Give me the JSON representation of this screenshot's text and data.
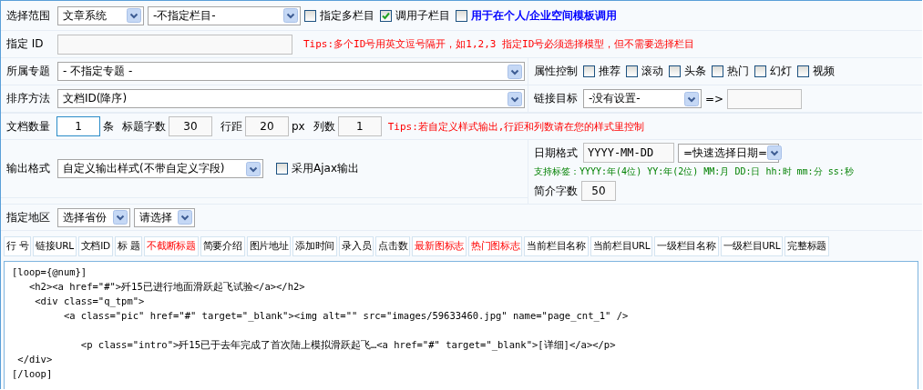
{
  "scope": {
    "label": "选择范围",
    "selects": [
      {
        "value": "文章系统"
      },
      {
        "value": "-不指定栏目-"
      }
    ],
    "checkboxes": [
      {
        "label": "指定多栏目",
        "checked": false,
        "emphasis": false
      },
      {
        "label": "调用子栏目",
        "checked": true,
        "emphasis": false
      },
      {
        "label": "用于在个人/企业空间模板调用",
        "checked": false,
        "emphasis": true
      }
    ]
  },
  "id_row": {
    "label": "指定 ID",
    "tip": "Tips:多个ID号用英文逗号隔开，如1,2,3 指定ID号必须选择模型，但不需要选择栏目"
  },
  "topic_row": {
    "label": "所属专题",
    "select": "- 不指定专题 -",
    "attributes": {
      "label": "属性控制",
      "checkboxes": [
        {
          "label": "推荐",
          "checked": false
        },
        {
          "label": "滚动",
          "checked": false
        },
        {
          "label": "头条",
          "checked": false
        },
        {
          "label": "热门",
          "checked": false
        },
        {
          "label": "幻灯",
          "checked": false
        },
        {
          "label": "视频",
          "checked": false
        }
      ]
    }
  },
  "sort_row": {
    "label": "排序方法",
    "select": "文档ID(降序)",
    "link_target": {
      "label": "链接目标",
      "select": "-没有设置-",
      "arrow": "=>"
    }
  },
  "count_row": {
    "items": [
      {
        "label": "文档数量",
        "value": "1",
        "unit": "条",
        "focused": true
      },
      {
        "label": "标题字数",
        "value": "30",
        "focused": false
      },
      {
        "label": "行距",
        "value": "20",
        "unit": "px",
        "focused": false
      },
      {
        "label": "列数",
        "value": "1",
        "focused": false
      }
    ],
    "tip": "Tips:若自定义样式输出,行距和列数请在您的样式里控制"
  },
  "output_row": {
    "label": "输出格式",
    "select": "自定义输出样式(不带自定义字段)",
    "ajax": {
      "label": "采用Ajax输出",
      "checked": false
    },
    "date": {
      "label": "日期格式",
      "value": "YYYY-MM-DD",
      "select": "=快速选择日期=",
      "hint": "支持标签：YYYY:年(4位) YY:年(2位) MM:月 DD:日 hh:时 mm:分 ss:秒"
    },
    "summary": {
      "label": "简介字数",
      "value": "50"
    }
  },
  "region_row": {
    "label": "指定地区",
    "selects": [
      "选择省份",
      "请选择"
    ]
  },
  "tags": [
    {
      "label": "行 号",
      "highlighted": false
    },
    {
      "label": "链接URL",
      "highlighted": false
    },
    {
      "label": "文档ID",
      "highlighted": false
    },
    {
      "label": "标 题",
      "highlighted": false
    },
    {
      "label": "不截断标题",
      "highlighted": true
    },
    {
      "label": "简要介绍",
      "highlighted": false
    },
    {
      "label": "图片地址",
      "highlighted": false
    },
    {
      "label": "添加时间",
      "highlighted": false
    },
    {
      "label": "录入员",
      "highlighted": false
    },
    {
      "label": "点击数",
      "highlighted": false
    },
    {
      "label": "最新图标志",
      "highlighted": true
    },
    {
      "label": "热门图标志",
      "highlighted": true
    },
    {
      "label": "当前栏目名称",
      "highlighted": false
    },
    {
      "label": "当前栏目URL",
      "highlighted": false
    },
    {
      "label": "一级栏目名称",
      "highlighted": false
    },
    {
      "label": "一级栏目URL",
      "highlighted": false
    },
    {
      "label": "完整标题",
      "highlighted": false
    }
  ],
  "template": "[loop={@num}]\n   <h2><a href=\"#\">歼15已进行地面滑跃起飞试验</a></h2>\n    <div class=\"q_tpm\">\n         <a class=\"pic\" href=\"#\" target=\"_blank\"><img alt=\"\" src=\"images/59633460.jpg\" name=\"page_cnt_1\" />\n\n            <p class=\"intro\">歼15已于去年完成了首次陆上模拟滑跃起飞…<a href=\"#\" target=\"_blank\">[详细]</a></p>\n </div>\n[/loop]"
}
